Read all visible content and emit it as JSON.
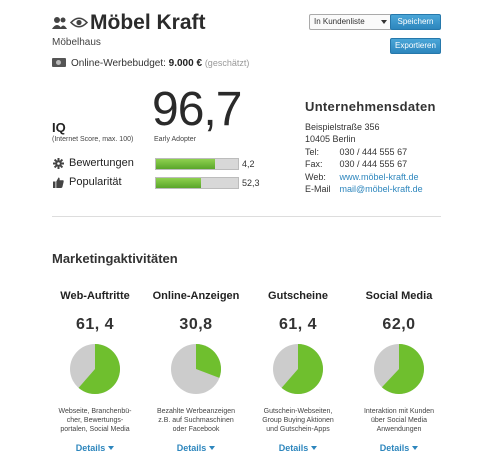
{
  "header": {
    "title": "Möbel Kraft",
    "subtitle": "Möbelhaus",
    "budget_label": "Online-Werbebudget:",
    "budget_value": "9.000 €",
    "budget_note": "(geschätzt)",
    "list_select": "In Kundenliste",
    "save_label": "Speichern",
    "export_label": "Exportieren"
  },
  "iq": {
    "label": "IQ",
    "sub": "(Internet Score, max. 100)",
    "value": "96,7",
    "adopter": "Early Adopter"
  },
  "metrics": [
    {
      "label": "Bewertungen",
      "value": "4,2",
      "fill": 0.72,
      "icon": "gear-icon"
    },
    {
      "label": "Popularität",
      "value": "52,3",
      "fill": 0.55,
      "icon": "thumbs-up-icon"
    }
  ],
  "company": {
    "title": "Unternehmensdaten",
    "street": "Beispielstraße 356",
    "city": "10405 Berlin",
    "tel_label": "Tel:",
    "tel": "030 / 444 555 67",
    "fax_label": "Fax:",
    "fax": "030 / 444 555 67",
    "web_label": "Web:",
    "web": "www.möbel-kraft.de",
    "email_label": "E-Mail",
    "email": "mail@möbel-kraft.de"
  },
  "marketing": {
    "title": "Marketingaktivitäten",
    "details_label": "Details",
    "columns": [
      {
        "title": "Web-Auftritte",
        "score": "61, 4",
        "pct": 61.4,
        "desc": [
          "Webseite, Branchenbü-",
          "cher, Bewertungs-",
          "portalen, Social Media"
        ]
      },
      {
        "title": "Online-Anzeigen",
        "score": "30,8",
        "pct": 30.8,
        "desc": [
          "Bezahlte Werbeanzeigen",
          "z.B. auf Suchmaschinen",
          "oder Facebook"
        ]
      },
      {
        "title": "Gutscheine",
        "score": "61, 4",
        "pct": 61.4,
        "desc": [
          "Gutschein-Webseiten,",
          "Group Buying Aktionen",
          "und Gutschein-Apps"
        ]
      },
      {
        "title": "Social Media",
        "score": "62,0",
        "pct": 62.0,
        "desc": [
          "Interaktion mit Kunden",
          "über Social Media",
          "Anwendungen"
        ]
      }
    ]
  },
  "colors": {
    "accent": "#2d86bd",
    "green": "#6fbf2e",
    "pie_bg": "#cccccc"
  }
}
